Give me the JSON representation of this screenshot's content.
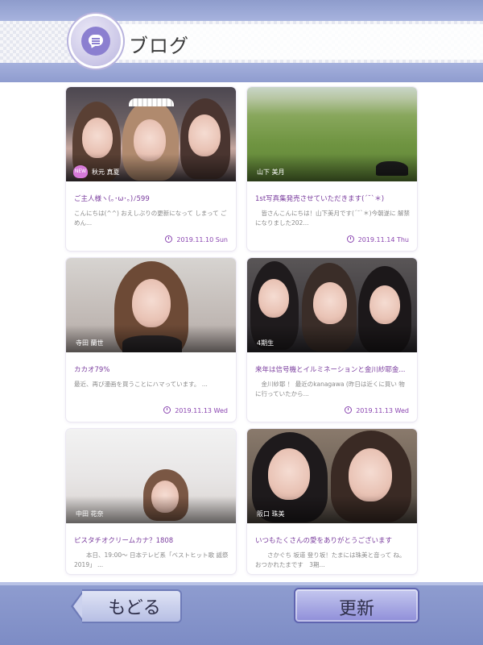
{
  "header": {
    "title": "ブログ",
    "icon": "blog-chat-icon"
  },
  "posts": [
    {
      "author": "秋元 真夏",
      "badge": "NEW",
      "title": "ご主人様ヽ(｡･ω･｡)ﾉ599",
      "excerpt": "こんにちは(^^) おえしぶりの更新になって しまって ごめん...",
      "date": "2019.11.10 Sun"
    },
    {
      "author": "山下 美月",
      "title": "1st写真集発売させていただきます(´˘`＊)",
      "excerpt": "　皆さんこんにちは！山下美月です(´˘`＊)今朝遂に 解禁になりました202...",
      "date": "2019.11.14 Thu"
    },
    {
      "author": "寺田 蘭世",
      "title": "カカオ79%",
      "excerpt": "最近、再び漫画を買うことにハマっています。 ...",
      "date": "2019.11.13 Wed"
    },
    {
      "author": "4期生",
      "title": "来年は信号機とイルミネーションと金川紗耶金...",
      "excerpt": "　金川紗耶 ！ 最近のkanagawa (昨日は近くに買い 物に行っていたから...",
      "date": "2019.11.13 Wed"
    },
    {
      "author": "中田 花奈",
      "title": "ピスタチオクリームカナ？1808",
      "excerpt": "　　本日、19:00〜 日本テレビ系「ベストヒット歌 謡祭2019」 ...",
      "date": ""
    },
    {
      "author": "阪口 珠美",
      "title": "いつもたくさんの愛をありがとうございます",
      "excerpt": "　　さかぐち 坂道 登り坂！たまには珠美と音って ね。　おつかれたまです　3期...",
      "date": ""
    }
  ],
  "footer": {
    "back_label": "もどる",
    "refresh_label": "更新"
  },
  "colors": {
    "accent": "#8a45b0",
    "title": "#7a3c9e",
    "bar": "#8f9dd0"
  }
}
